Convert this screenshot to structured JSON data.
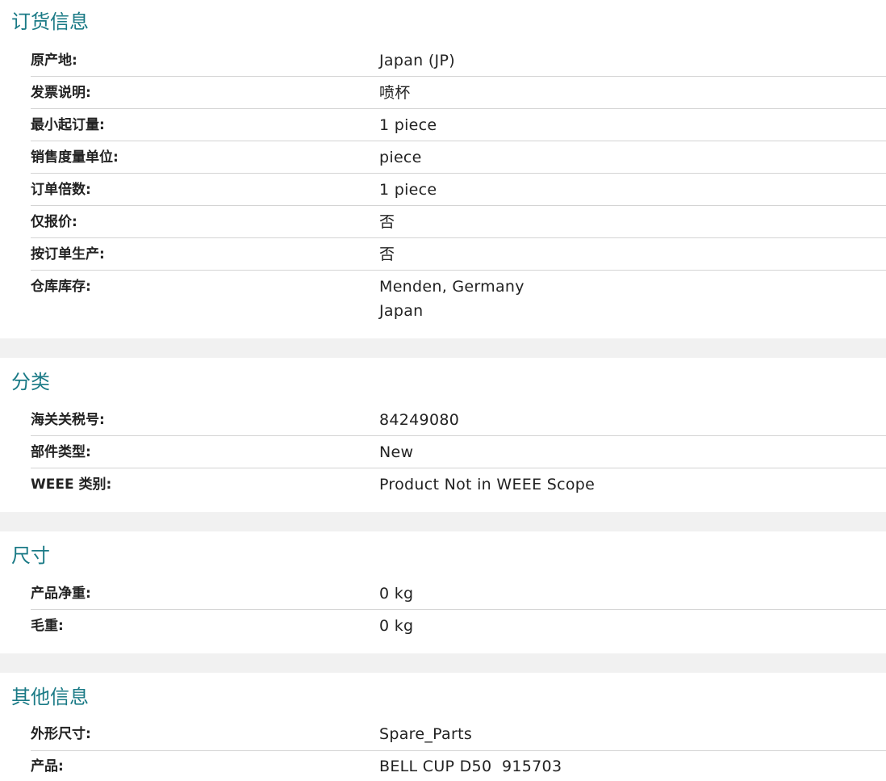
{
  "sections": [
    {
      "title": "订货信息",
      "rows": [
        {
          "label": "原产地:",
          "value": "Japan (JP)"
        },
        {
          "label": "发票说明:",
          "value": "喷杯"
        },
        {
          "label": "最小起订量:",
          "value": "1 piece"
        },
        {
          "label": "销售度量单位:",
          "value": "piece"
        },
        {
          "label": "订单倍数:",
          "value": "1 piece"
        },
        {
          "label": "仅报价:",
          "value": "否"
        },
        {
          "label": "按订单生产:",
          "value": "否"
        },
        {
          "label": "仓库库存:",
          "values": [
            "Menden, Germany",
            "Japan"
          ]
        }
      ]
    },
    {
      "title": "分类",
      "rows": [
        {
          "label": "海关关税号:",
          "value": "84249080"
        },
        {
          "label": "部件类型:",
          "value": "New"
        },
        {
          "label": "WEEE 类别:",
          "value": "Product Not in WEEE Scope"
        }
      ]
    },
    {
      "title": "尺寸",
      "rows": [
        {
          "label": "产品净重:",
          "value": "0 kg"
        },
        {
          "label": "毛重:",
          "value": "0 kg"
        }
      ]
    },
    {
      "title": "其他信息",
      "rows": [
        {
          "label": "外形尺寸:",
          "value": "Spare_Parts"
        },
        {
          "label": "产品:",
          "value": "BELL CUP D50  915703"
        }
      ]
    }
  ],
  "colors": {
    "section_title": "#1a7a86",
    "separator_band": "#f1f1f1",
    "row_divider": "#d4d4d4",
    "text": "#222222"
  }
}
